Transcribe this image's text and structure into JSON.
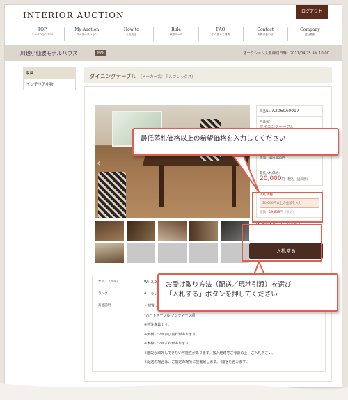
{
  "header": {
    "logo": "INTERIOR AUCTION",
    "logout": "ログアウト",
    "nav": [
      {
        "main": "TOP",
        "sub": "オークションTOP"
      },
      {
        "main": "My Auction",
        "sub": "マイオークション"
      },
      {
        "main": "How to",
        "sub": "入札方法"
      },
      {
        "main": "Rule",
        "sub": "参加ルール"
      },
      {
        "main": "FAQ",
        "sub": "よくあるご質問"
      },
      {
        "main": "Contact",
        "sub": "お問い合わせ"
      },
      {
        "main": "Company",
        "sub": "会社概要"
      }
    ]
  },
  "auction_bar": {
    "title": "川越小仙波モデルハウス",
    "map": "MAP",
    "deadline": "オークション入札締切日時：2011/04/25 AM 10:00"
  },
  "sidebar": {
    "heading": "家具",
    "items": [
      "インテリア小物"
    ]
  },
  "item": {
    "title": "ダイニングテーブル",
    "maker": "（メーカー名：アルフレックス）",
    "lot_label": "商品No.",
    "lot_no": "A2060A0017",
    "name_label": "商品名：",
    "name": "ダイニングテーブル",
    "price_partial": "定価：420,000円",
    "min_label": "最低入札価格：",
    "min_price": "20,000",
    "min_unit": "円（税込・送料別）"
  },
  "bid": {
    "label": "入札価格",
    "placeholder": "20,000円以上の金額を入力",
    "total_label": "総額：",
    "total_value": "19,858",
    "total_unit": "円（税込）",
    "options": [
      "配送する",
      "お受取り"
    ],
    "selected": "配送する",
    "button": "入札する"
  },
  "specs": {
    "size_label": "サイズ（mm）",
    "size_value": "W：2,000",
    "rank_label": "ランク",
    "rank_value": "A",
    "rank_link": "ランクに",
    "desc_label": "商品説明",
    "desc_lines": [
      "・材質:木製",
      "*ハードメープル アンティーク調",
      "※特注家具です。",
      "※天板に少々ひび割れがあります。",
      "※木枠に少々ずれがあります。",
      "※階段が取外しできない可能性があります。搬入経路等ご考慮の上、ご入札下さい。",
      "※配送の場合は、ご指定の場所に設置致します。（開梱を含みます。）"
    ]
  },
  "callouts": {
    "c1": "最低落札価格以上の希望価格を入力してください",
    "c2_line1": "お受け取り方法（配送／現地引渡）を選び",
    "c2_line2": "「入札する」ボタンを押してください"
  },
  "colors": {
    "accent": "#e25f4e",
    "brand": "#4a2c20",
    "price": "#c0392b"
  }
}
